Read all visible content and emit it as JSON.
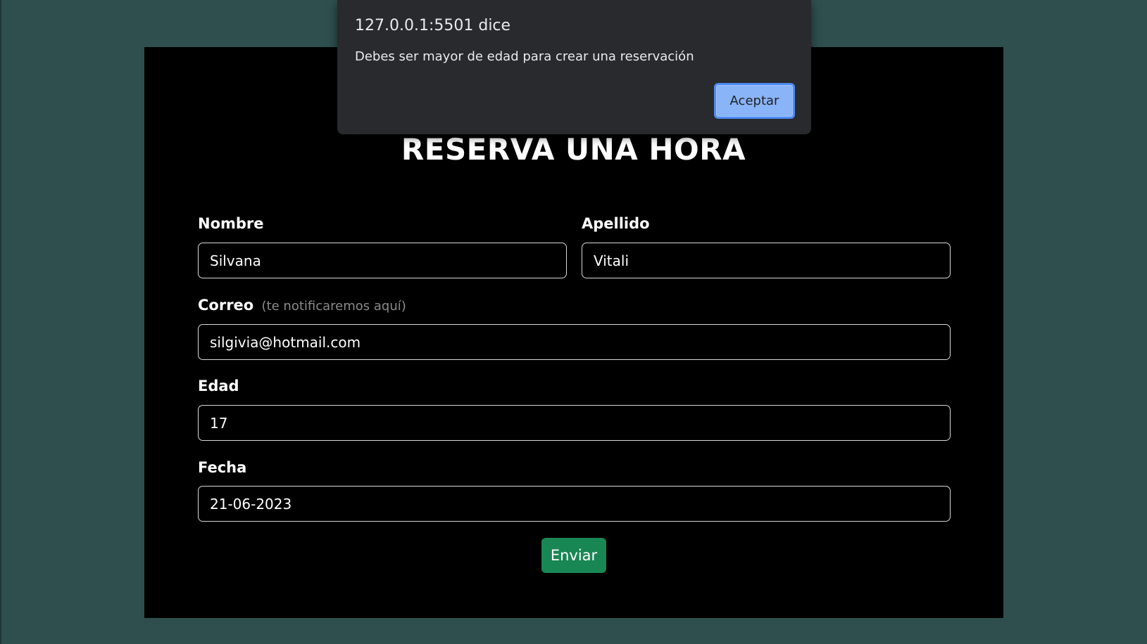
{
  "form": {
    "title": "RESERVA UNA HORA",
    "nombre_label": "Nombre",
    "nombre_value": "Silvana",
    "apellido_label": "Apellido",
    "apellido_value": "Vitali",
    "correo_label": "Correo",
    "correo_hint": "(te notificaremos aquí)",
    "correo_value": "silgivia@hotmail.com",
    "edad_label": "Edad",
    "edad_value": "17",
    "fecha_label": "Fecha",
    "fecha_value": "21-06-2023",
    "submit_label": "Enviar"
  },
  "dialog": {
    "origin": "127.0.0.1:5501 dice",
    "message": "Debes ser mayor de edad para crear una reservación",
    "ok_label": "Aceptar"
  },
  "colors": {
    "page_background": "#2f4f4f",
    "card_background": "#000000",
    "submit_button": "#198754",
    "dialog_background": "#292a2d",
    "dialog_button": "#8ab4f8"
  }
}
